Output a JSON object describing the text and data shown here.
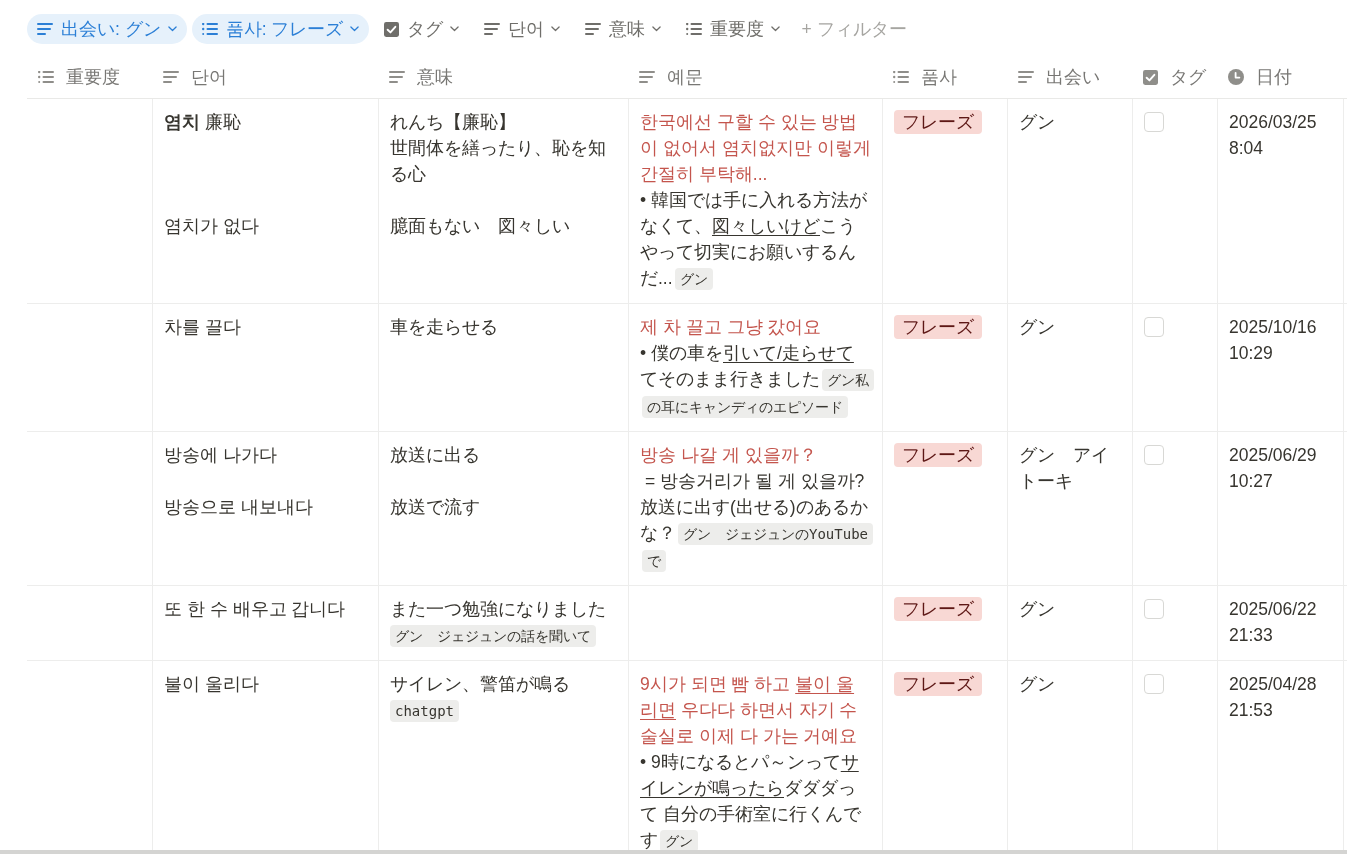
{
  "filters": [
    {
      "label": "出会い: グン",
      "kind": "text",
      "active": true
    },
    {
      "label": "품사: フレーズ",
      "kind": "multi_select",
      "active": true
    },
    {
      "label": "タグ",
      "kind": "checkbox",
      "active": false
    },
    {
      "label": "단어",
      "kind": "text",
      "active": false
    },
    {
      "label": "意味",
      "kind": "text",
      "active": false
    },
    {
      "label": "重要度",
      "kind": "multi_select",
      "active": false
    }
  ],
  "add_filter": "+ フィルター",
  "columns": [
    {
      "label": "重要度",
      "kind": "multi_select"
    },
    {
      "label": "단어",
      "kind": "text"
    },
    {
      "label": "意味",
      "kind": "text"
    },
    {
      "label": "예문",
      "kind": "text"
    },
    {
      "label": "품사",
      "kind": "multi_select"
    },
    {
      "label": "出会い",
      "kind": "text"
    },
    {
      "label": "タグ",
      "kind": "checkbox"
    },
    {
      "label": "日付",
      "kind": "date"
    }
  ],
  "rows": [
    {
      "word": "**염치** 廉恥\n\n\n\n염치가 없다",
      "meaning": [
        {
          "kind": "text",
          "lines": [
            "れんち【廉恥】",
            "世間体を繕ったり、恥を知る心"
          ]
        },
        {
          "kind": "text",
          "lines": [
            "臆面もない　図々しい"
          ]
        }
      ],
      "example": [
        {
          "color": "#c4554d",
          "segments": [
            {
              "kind": "text",
              "text": "한국에선 구할 수 있는 방법이 없어서 염치없지만 이렇게 간절히 부탁해..."
            }
          ]
        },
        {
          "color": "#37352f",
          "segments": [
            {
              "kind": "text",
              "text": "• 韓国では手に入れる方法がなくて、"
            },
            {
              "kind": "underline",
              "text": "図々しいけど"
            },
            {
              "kind": "text",
              "text": "こうやって切実にお願いするんだ..."
            },
            {
              "kind": "code",
              "text": "グン"
            }
          ]
        }
      ],
      "part_of_speech": [
        {
          "label": "フレーズ",
          "color": "#f8d8d4"
        }
      ],
      "encounter": "グン",
      "tag": false,
      "date": "2026/03/25 8:04"
    },
    {
      "word": "차를 끌다",
      "meaning": [
        {
          "kind": "text",
          "lines": [
            "車を走らせる"
          ]
        }
      ],
      "example": [
        {
          "color": "#c4554d",
          "segments": [
            {
              "kind": "text",
              "text": "제 차 끌고 그냥 갔어요"
            }
          ]
        },
        {
          "color": "#37352f",
          "segments": [
            {
              "kind": "text",
              "text": "• 僕の車を"
            },
            {
              "kind": "underline",
              "text": "引いて/走らせて"
            },
            {
              "kind": "text",
              "text": "てそのまま行きました"
            },
            {
              "kind": "code",
              "text": "グン私の耳にキャンディのエピソード"
            }
          ]
        }
      ],
      "part_of_speech": [
        {
          "label": "フレーズ",
          "color": "#f8d8d4"
        }
      ],
      "encounter": "グン",
      "tag": false,
      "date": "2025/10/16 10:29"
    },
    {
      "word": "방송에 나가다\n\n방송으로 내보내다",
      "meaning": [
        {
          "kind": "text",
          "lines": [
            "放送に出る"
          ]
        },
        {
          "kind": "text",
          "lines": [
            "放送で流す"
          ]
        }
      ],
      "example": [
        {
          "color": "#c4554d",
          "segments": [
            {
              "kind": "text",
              "text": "방송 나갈 게 있을까？"
            }
          ]
        },
        {
          "color": "#37352f",
          "segments": [
            {
              "kind": "text",
              "text": " = 방송거리가 될 게 있을까?"
            }
          ]
        },
        {
          "color": "#37352f",
          "segments": [
            {
              "kind": "text",
              "text": "放送に出す(出せる)のあるかな？"
            },
            {
              "kind": "code",
              "text": "グン　ジェジュンのYouTubeで"
            }
          ]
        }
      ],
      "part_of_speech": [
        {
          "label": "フレーズ",
          "color": "#f8d8d4"
        }
      ],
      "encounter": "グン　アイトーキ",
      "tag": false,
      "date": "2025/06/29 10:27"
    },
    {
      "word": "또 한 수 배우고 갑니다",
      "meaning": [
        {
          "kind": "text",
          "lines": [
            "また一つ勉強になりました"
          ]
        },
        {
          "kind": "code",
          "text": "グン　ジェジュンの話を聞いて"
        }
      ],
      "part_of_speech": [
        {
          "label": "フレーズ",
          "color": "#f8d8d4"
        }
      ],
      "encounter": "グン",
      "tag": false,
      "date": "2025/06/22 21:33"
    },
    {
      "word": "불이 울리다",
      "meaning": [
        {
          "kind": "text",
          "lines": [
            "サイレン、警笛が鳴る"
          ]
        },
        {
          "kind": "code",
          "text": "chatgpt"
        }
      ],
      "example": [
        {
          "color": "#c4554d",
          "segments": [
            {
              "kind": "text",
              "text": "9시가 되면 빰 하고 "
            },
            {
              "kind": "underline",
              "text": "불이 울리면"
            },
            {
              "kind": "text",
              "text": " 우다다 하면서 자기 수술실로 이제 다 가는 거예요"
            }
          ]
        },
        {
          "color": "#37352f",
          "segments": [
            {
              "kind": "text",
              "text": "• 9時になるとパ～ンって"
            },
            {
              "kind": "underline",
              "text": "サイレンが鳴ったら"
            },
            {
              "kind": "text",
              "text": "ダダダって 自分の手術室に行くんです"
            },
            {
              "kind": "code",
              "text": "グン"
            }
          ]
        }
      ],
      "part_of_speech": [
        {
          "label": "フレーズ",
          "color": "#f8d8d4"
        }
      ],
      "encounter": "グン",
      "tag": false,
      "date": "2025/04/28 21:53"
    }
  ]
}
